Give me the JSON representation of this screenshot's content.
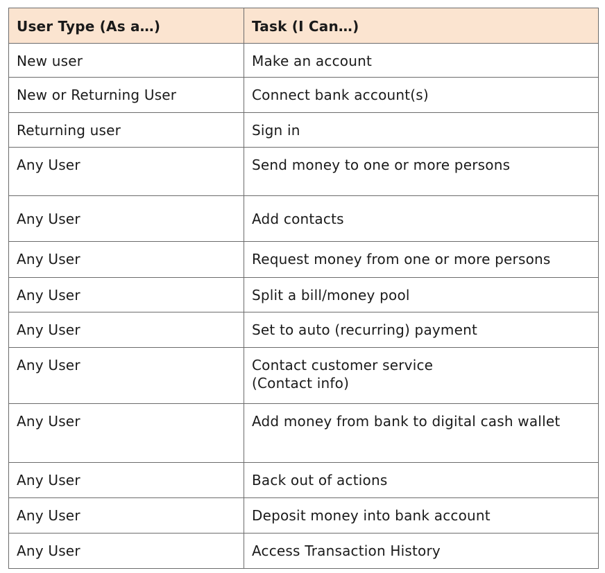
{
  "table": {
    "headers": [
      "User Type (As a…)",
      "Task (I Can…)"
    ],
    "rows": [
      {
        "user": "New user",
        "task": "Make an account"
      },
      {
        "user": "New or Returning User",
        "task": "Connect bank account(s)"
      },
      {
        "user": "Returning user",
        "task": "Sign in"
      },
      {
        "user": "Any User",
        "task": "Send money to one or more persons"
      },
      {
        "user": "Any User",
        "task": "Add contacts"
      },
      {
        "user": "Any User",
        "task": "Request money from one or more persons"
      },
      {
        "user": "Any User",
        "task": "Split a bill/money pool"
      },
      {
        "user": "Any User",
        "task": "Set to auto (recurring) payment"
      },
      {
        "user": "Any User",
        "task": "Contact customer service\n(Contact info)"
      },
      {
        "user": "Any User",
        "task": "Add money from bank to digital cash wallet"
      },
      {
        "user": "Any User",
        "task": "Back out of actions"
      },
      {
        "user": "Any User",
        "task": "Deposit money into bank account"
      },
      {
        "user": "Any User",
        "task": "Access Transaction History"
      }
    ]
  }
}
